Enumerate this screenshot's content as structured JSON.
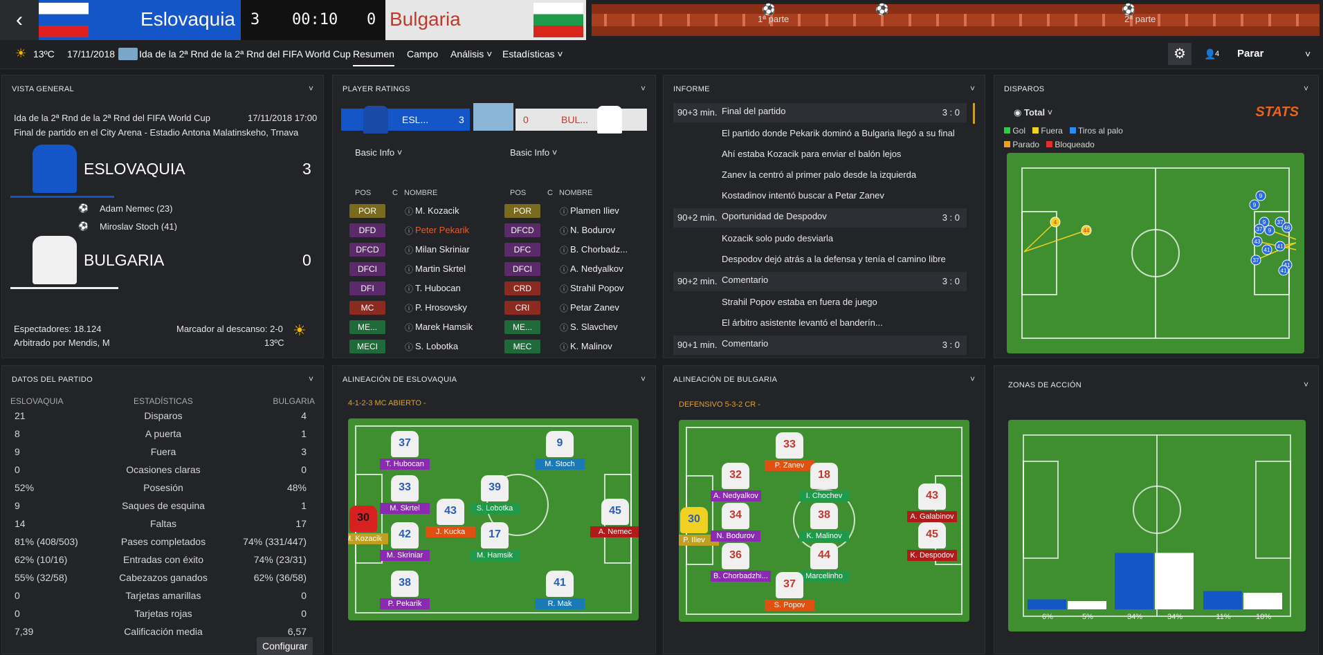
{
  "header": {
    "home_name": "Eslovaquia",
    "away_name": "Bulgaria",
    "home_score": "3",
    "away_score": "0",
    "clock": "00:10",
    "back_icon": "back-arrow-icon",
    "timeline_labels": [
      "1ª parte",
      "2ª parte"
    ]
  },
  "menubar": {
    "temp": "13ºC",
    "date": "17/11/2018",
    "competition": "Ida de la 2ª Rnd de la 2ª Rnd del FIFA World Cup",
    "tabs": [
      "Resumen",
      "Campo",
      "Análisis",
      "Estadísticas"
    ],
    "players_count": "4",
    "stop_label": "Parar"
  },
  "overview": {
    "title": "VISTA GENERAL",
    "competition": "Ida de la 2ª Rnd de la 2ª Rnd del FIFA World Cup",
    "datetime": "17/11/2018 17:00",
    "venue": "Final de partido en el City Arena - Estadio Antona Malatinskeho, Trnava",
    "home": "ESLOVAQUIA",
    "home_score": "3",
    "away": "BULGARIA",
    "away_score": "0",
    "scorers": [
      "Adam Nemec (23)",
      "Miroslav Stoch (41)"
    ],
    "attendance": "Espectadores: 18.124",
    "referee": "Arbitrado por Mendis, M",
    "halftime": "Marcador al descanso: 2-0",
    "weather_temp": "13ºC"
  },
  "ratings": {
    "title": "PLAYER RATINGS",
    "home_abbr": "ESL...",
    "home_score": "3",
    "away_abbr": "BUL...",
    "away_score": "0",
    "dropdown": "Basic Info",
    "col_pos": "POS",
    "col_c": "C",
    "col_name": "NOMBRE",
    "home_rows": [
      {
        "pos": "POR",
        "name": "M. Kozacik"
      },
      {
        "pos": "DFD",
        "name": "Peter Pekarik"
      },
      {
        "pos": "DFCD",
        "name": "Milan Skriniar"
      },
      {
        "pos": "DFCI",
        "name": "Martin Skrtel"
      },
      {
        "pos": "DFI",
        "name": "T. Hubocan"
      },
      {
        "pos": "MC",
        "name": "P. Hrosovsky"
      },
      {
        "pos": "ME...",
        "name": "Marek Hamsik"
      },
      {
        "pos": "MECI",
        "name": "S. Lobotka"
      }
    ],
    "away_rows": [
      {
        "pos": "POR",
        "name": "Plamen Iliev"
      },
      {
        "pos": "DFCD",
        "name": "N. Bodurov"
      },
      {
        "pos": "DFC",
        "name": "B. Chorbadz..."
      },
      {
        "pos": "DFCI",
        "name": "A. Nedyalkov"
      },
      {
        "pos": "CRD",
        "name": "Strahil Popov"
      },
      {
        "pos": "CRI",
        "name": "Petar Zanev"
      },
      {
        "pos": "ME...",
        "name": "S. Slavchev"
      },
      {
        "pos": "MEC",
        "name": "K. Malinov"
      }
    ]
  },
  "report": {
    "title": "INFORME",
    "items": [
      {
        "min": "90+3 min.",
        "head": "Final del partido",
        "score": "3 : 0",
        "lines": [
          "El partido donde Pekarik dominó a Bulgaria llegó a su final",
          "Ahí estaba Kozacik para enviar el balón lejos",
          "Zanev la centró al primer palo desde la izquierda",
          "Kostadinov intentó buscar a Petar Zanev"
        ]
      },
      {
        "min": "90+2 min.",
        "head": "Oportunidad de Despodov",
        "score": "3 : 0",
        "lines": [
          "Kozacik solo pudo desviarla",
          "Despodov dejó atrás a la defensa y tenía el camino libre"
        ]
      },
      {
        "min": "90+2 min.",
        "head": "Comentario",
        "score": "3 : 0",
        "lines": [
          "Strahil Popov estaba en fuera de juego",
          "El árbitro asistente levantó el banderín..."
        ]
      },
      {
        "min": "90+1 min.",
        "head": "Comentario",
        "score": "3 : 0",
        "lines": []
      }
    ]
  },
  "shots": {
    "title": "DISPAROS",
    "filter": "Total",
    "brand": "STATS",
    "legend": [
      "Gol",
      "Fuera",
      "Tiros al palo",
      "Parado",
      "Bloqueado"
    ],
    "colors": {
      "gol": "#2ecc40",
      "fuera": "#f0d020",
      "palo": "#2a8cf0",
      "parado": "#f0a020",
      "bloqueado": "#e03030"
    }
  },
  "matchdata": {
    "title": "DATOS DEL PARTIDO",
    "home": "ESLOVAQUIA",
    "mid": "ESTADÍSTICAS",
    "away": "BULGARIA",
    "config": "Configurar",
    "rows": [
      {
        "h": "21",
        "l": "Disparos",
        "a": "4"
      },
      {
        "h": "8",
        "l": "A puerta",
        "a": "1"
      },
      {
        "h": "9",
        "l": "Fuera",
        "a": "3"
      },
      {
        "h": "0",
        "l": "Ocasiones claras",
        "a": "0"
      },
      {
        "h": "52%",
        "l": "Posesión",
        "a": "48%"
      },
      {
        "h": "9",
        "l": "Saques de esquina",
        "a": "1"
      },
      {
        "h": "14",
        "l": "Faltas",
        "a": "17"
      },
      {
        "h": "81% (408/503)",
        "l": "Pases completados",
        "a": "74% (331/447)"
      },
      {
        "h": "62% (10/16)",
        "l": "Entradas con éxito",
        "a": "74% (23/31)"
      },
      {
        "h": "55% (32/58)",
        "l": "Cabezazos ganados",
        "a": "62% (36/58)"
      },
      {
        "h": "0",
        "l": "Tarjetas amarillas",
        "a": "0"
      },
      {
        "h": "0",
        "l": "Tarjetas rojas",
        "a": "0"
      },
      {
        "h": "7,39",
        "l": "Calificación media",
        "a": "6,57"
      }
    ]
  },
  "lineup_home": {
    "title": "ALINEACIÓN DE ESLOVAQUIA",
    "formation": "4-1-2-3 MC ABIERTO -"
  },
  "lineup_away": {
    "title": "ALINEACIÓN DE BULGARIA",
    "formation": "DEFENSIVO 5-3-2 CR -"
  },
  "home_players": [
    {
      "num": "30",
      "name": "M. Kozacik"
    },
    {
      "num": "37",
      "name": "T. Hubocan"
    },
    {
      "num": "33",
      "name": "M. Skrtel"
    },
    {
      "num": "42",
      "name": "M. Skriniar"
    },
    {
      "num": "38",
      "name": "P. Pekarik"
    },
    {
      "num": "43",
      "name": "J. Kucka"
    },
    {
      "num": "39",
      "name": "S. Lobotka"
    },
    {
      "num": "17",
      "name": "M. Hamsik"
    },
    {
      "num": "9",
      "name": "M. Stoch"
    },
    {
      "num": "45",
      "name": "A. Nemec"
    },
    {
      "num": "41",
      "name": "R. Mak"
    }
  ],
  "away_players": [
    {
      "num": "30",
      "name": "P. Iliev"
    },
    {
      "num": "32",
      "name": "A. Nedyalkov"
    },
    {
      "num": "34",
      "name": "N. Bodurov"
    },
    {
      "num": "36",
      "name": "B. Chorbadzhi..."
    },
    {
      "num": "33",
      "name": "P. Zanev"
    },
    {
      "num": "18",
      "name": "I. Chochev"
    },
    {
      "num": "38",
      "name": "K. Malinov"
    },
    {
      "num": "44",
      "name": "Marcelinho"
    },
    {
      "num": "37",
      "name": "S. Popov"
    },
    {
      "num": "43",
      "name": "A. Galabinov"
    },
    {
      "num": "45",
      "name": "K. Despodov"
    }
  ],
  "zones": {
    "title": "ZONAS DE ACCIÓN",
    "values": [
      {
        "h": 6,
        "a": 5
      },
      {
        "h": 34,
        "a": 34
      },
      {
        "h": 11,
        "a": 10
      }
    ],
    "labels": [
      "6%",
      "5%",
      "34%",
      "34%",
      "11%",
      "10%"
    ]
  }
}
